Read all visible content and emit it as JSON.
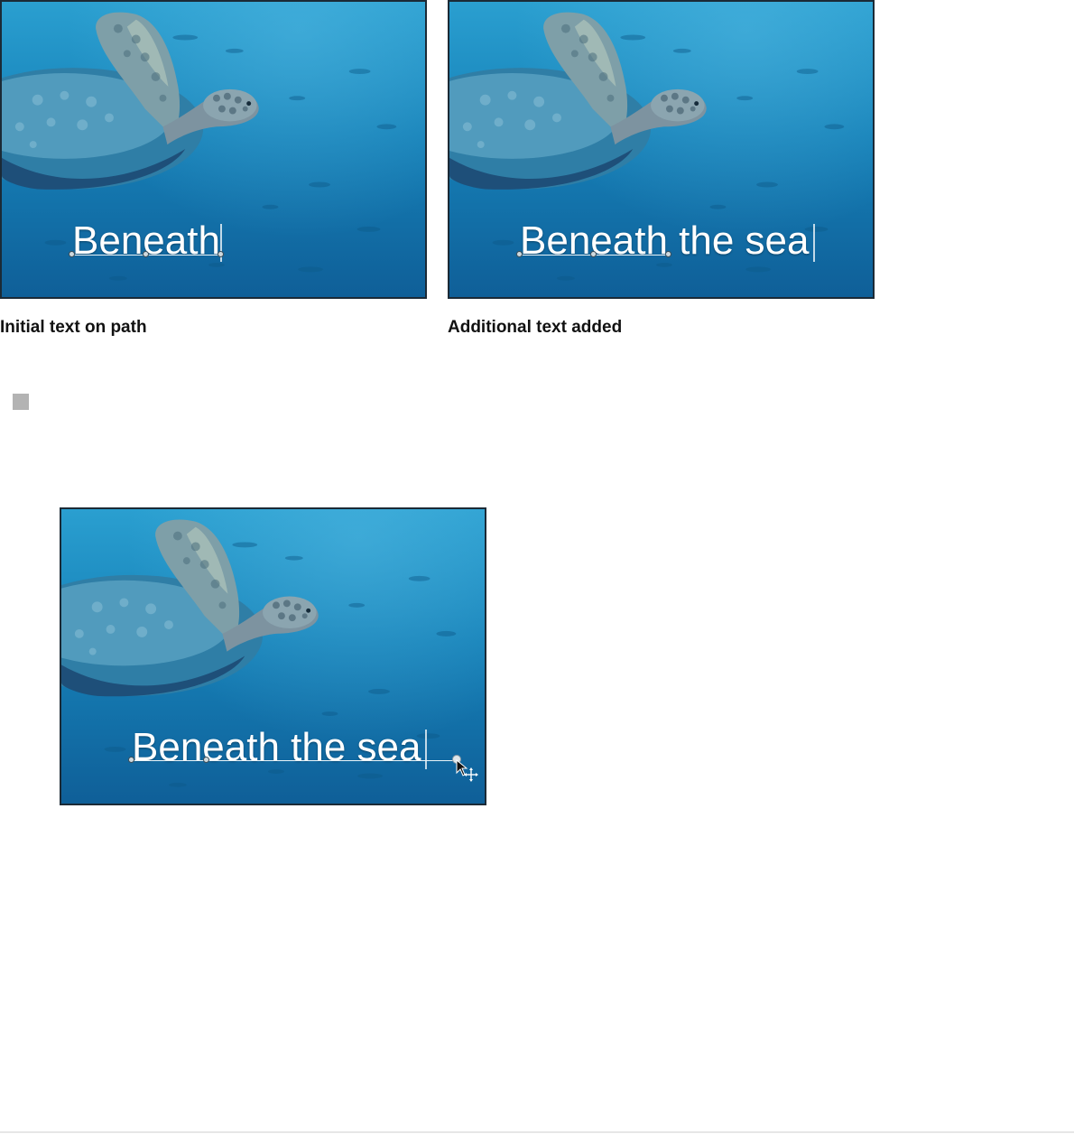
{
  "figures": [
    {
      "overlay_text": "Beneath",
      "caption": "Initial text on path"
    },
    {
      "overlay_text": "Beneath the sea",
      "caption": "Additional text added"
    },
    {
      "overlay_text": "Beneath the sea"
    }
  ],
  "colors": {
    "water_top": "#2a9fd0",
    "water_bottom": "#0f5f98",
    "text": "#ffffff",
    "bullet": "#b3b3b3"
  },
  "icons": {
    "bullet": "square-bullet-icon",
    "cursor": "move-pointer-icon"
  }
}
